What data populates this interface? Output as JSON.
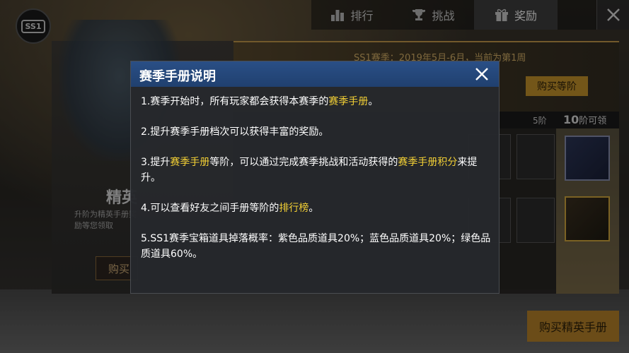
{
  "nav": {
    "tabs": [
      {
        "label": "排行",
        "icon": "ranking-icon"
      },
      {
        "label": "挑战",
        "icon": "trophy-icon"
      },
      {
        "label": "奖励",
        "icon": "gift-icon"
      }
    ],
    "active_tab": "奖励"
  },
  "season_badge": "SS1",
  "elite_panel": {
    "title": "精英",
    "desc": "升阶为精英手册奖励等您领取",
    "buy_label": "购买"
  },
  "season_panel": {
    "info": "SS1赛季：2019年5月-6月，当前为第1周",
    "buy_level_label": "购买等阶",
    "level_5": "5阶",
    "level_10_num": "10",
    "level_10_text": "阶可领"
  },
  "buy_elite_label": "购买精英手册",
  "modal": {
    "title": "赛季手册说明",
    "rules": [
      {
        "segments": [
          "1.赛季开始时，所有玩家都会获得本赛季的",
          "赛季手册",
          "。"
        ]
      },
      {
        "segments": [
          "2.提升赛季手册档次可以获得丰富的奖励。"
        ]
      },
      {
        "segments": [
          "3.提升",
          "赛季手册",
          "等阶，可以通过完成赛季挑战和活动获得的",
          "赛季手册积分",
          "来提升。"
        ]
      },
      {
        "segments": [
          "4.可以查看好友之间手册等阶的",
          "排行榜",
          "。"
        ]
      },
      {
        "segments": [
          "5.SS1赛季宝箱道具掉落概率：紫色品质道具20%；蓝色品质道具20%；绿色品质道具60%。"
        ]
      }
    ]
  },
  "colors": {
    "highlight": "#f3d035",
    "header_blue": "#2a4f86",
    "gold": "#c7952c"
  }
}
